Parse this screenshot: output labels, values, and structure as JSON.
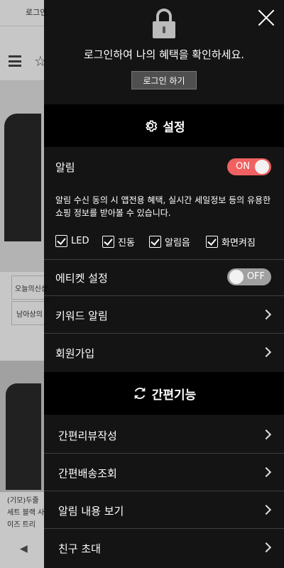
{
  "background": {
    "login_link": "로그인",
    "side_tag_1": "오늘의신상",
    "side_tag_2": "남아상의",
    "product_caption": "(기모)두줄 세트 블랙 사이즈 트리"
  },
  "drawer": {
    "login_message": "로그인하여 나의 혜택을 확인하세요.",
    "login_button": "로그인 하기",
    "settings_title": "설정",
    "notification": {
      "label": "알림",
      "toggle": "ON",
      "description": "알림 수신 동의 시 앱전용 혜택, 실시간 세일정보 등의 유용한 쇼핑 정보를 받아볼 수 있습니다.",
      "options": [
        {
          "label": "LED",
          "checked": true
        },
        {
          "label": "진동",
          "checked": true
        },
        {
          "label": "알림음",
          "checked": true
        },
        {
          "label": "화면켜짐",
          "checked": true
        }
      ]
    },
    "etiquette": {
      "label": "에티켓 설정",
      "toggle": "OFF"
    },
    "keyword_alert": "키워드 알림",
    "signup": "회원가입",
    "quick_title": "간편기능",
    "quick_items": [
      "간편리뷰작성",
      "간편배송조회",
      "알림 내용 보기",
      "친구 초대"
    ]
  },
  "colors": {
    "toggle_on": "#f06161",
    "toggle_off": "#a0a0a0",
    "drawer_bg": "#000000"
  }
}
